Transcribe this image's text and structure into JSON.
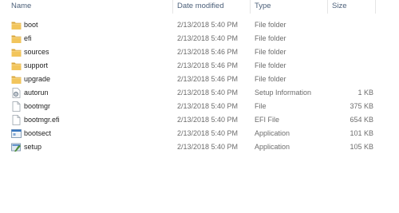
{
  "columns": {
    "name": "Name",
    "date": "Date modified",
    "type": "Type",
    "size": "Size"
  },
  "rows": [
    {
      "name": "boot",
      "date": "2/13/2018 5:40 PM",
      "type": "File folder",
      "size": "",
      "icon": "folder-icon"
    },
    {
      "name": "efi",
      "date": "2/13/2018 5:40 PM",
      "type": "File folder",
      "size": "",
      "icon": "folder-icon"
    },
    {
      "name": "sources",
      "date": "2/13/2018 5:46 PM",
      "type": "File folder",
      "size": "",
      "icon": "folder-icon"
    },
    {
      "name": "support",
      "date": "2/13/2018 5:46 PM",
      "type": "File folder",
      "size": "",
      "icon": "folder-icon"
    },
    {
      "name": "upgrade",
      "date": "2/13/2018 5:46 PM",
      "type": "File folder",
      "size": "",
      "icon": "folder-icon"
    },
    {
      "name": "autorun",
      "date": "2/13/2018 5:40 PM",
      "type": "Setup Information",
      "size": "1 KB",
      "icon": "settings-file-icon"
    },
    {
      "name": "bootmgr",
      "date": "2/13/2018 5:40 PM",
      "type": "File",
      "size": "375 KB",
      "icon": "blank-file-icon"
    },
    {
      "name": "bootmgr.efi",
      "date": "2/13/2018 5:40 PM",
      "type": "EFI File",
      "size": "654 KB",
      "icon": "blank-file-icon"
    },
    {
      "name": "bootsect",
      "date": "2/13/2018 5:40 PM",
      "type": "Application",
      "size": "101 KB",
      "icon": "application-icon"
    },
    {
      "name": "setup",
      "date": "2/13/2018 5:40 PM",
      "type": "Application",
      "size": "105 KB",
      "icon": "setup-application-icon"
    }
  ],
  "colors": {
    "header_text": "#4c607a",
    "folder": "#e8b84a",
    "detail_text": "#6d6d6d"
  }
}
